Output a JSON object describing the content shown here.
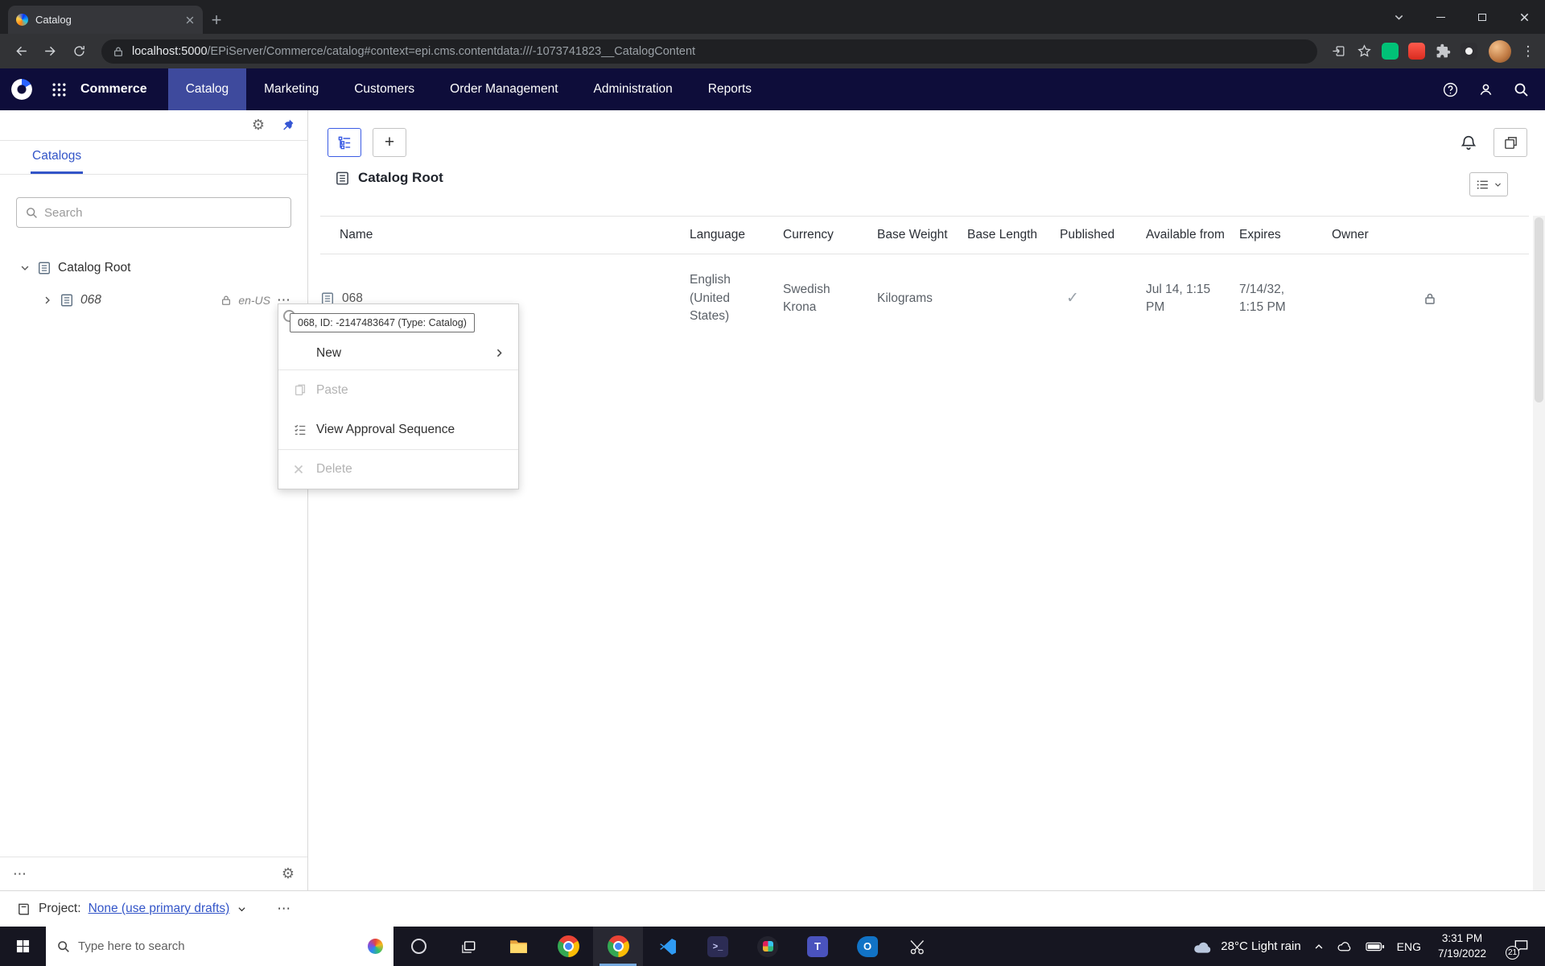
{
  "browser": {
    "tab_title": "Catalog",
    "url_host": "localhost:5000",
    "url_path": "/EPiServer/Commerce/catalog#context=epi.cms.contentdata:///-1073741823__CatalogContent"
  },
  "nav": {
    "app_title": "Commerce",
    "items": [
      {
        "label": "Catalog",
        "active": true
      },
      {
        "label": "Marketing"
      },
      {
        "label": "Customers"
      },
      {
        "label": "Order Management"
      },
      {
        "label": "Administration"
      },
      {
        "label": "Reports"
      }
    ]
  },
  "sidebar": {
    "tab_label": "Catalogs",
    "search_placeholder": "Search",
    "tree": {
      "root": "Catalog Root",
      "child": "068",
      "child_language": "en-US"
    }
  },
  "context_menu": {
    "tooltip": "068, ID: -2147483647 (Type: Catalog)",
    "items": [
      {
        "label": "New",
        "enabled": true,
        "submenu": true
      },
      {
        "label": "Paste",
        "enabled": false
      },
      {
        "label": "View Approval Sequence",
        "enabled": true
      },
      {
        "label": "Delete",
        "enabled": false
      }
    ]
  },
  "main": {
    "title": "Catalog Root",
    "table": {
      "columns": [
        "Name",
        "Language",
        "Currency",
        "Base Weight",
        "Base Length",
        "Published",
        "Available from",
        "Expires",
        "Owner"
      ],
      "rows": [
        {
          "name": "068",
          "language": "English (United States)",
          "currency": "Swedish Krona",
          "base_weight": "Kilograms",
          "base_length": "",
          "published": "✓",
          "available_from": "Jul 14, 1:15 PM",
          "expires": "7/14/32, 1:15 PM",
          "owner": "locked"
        }
      ]
    }
  },
  "project_bar": {
    "label": "Project:",
    "value": "None (use primary drafts)"
  },
  "taskbar": {
    "search_placeholder": "Type here to search",
    "tray": {
      "weather": "28°C Light rain",
      "language": "ENG",
      "time": "3:31 PM",
      "date": "7/19/2022",
      "notification_count": "21"
    }
  },
  "icons": {
    "more": "⋯",
    "kebab": "⋮",
    "plus": "+"
  }
}
